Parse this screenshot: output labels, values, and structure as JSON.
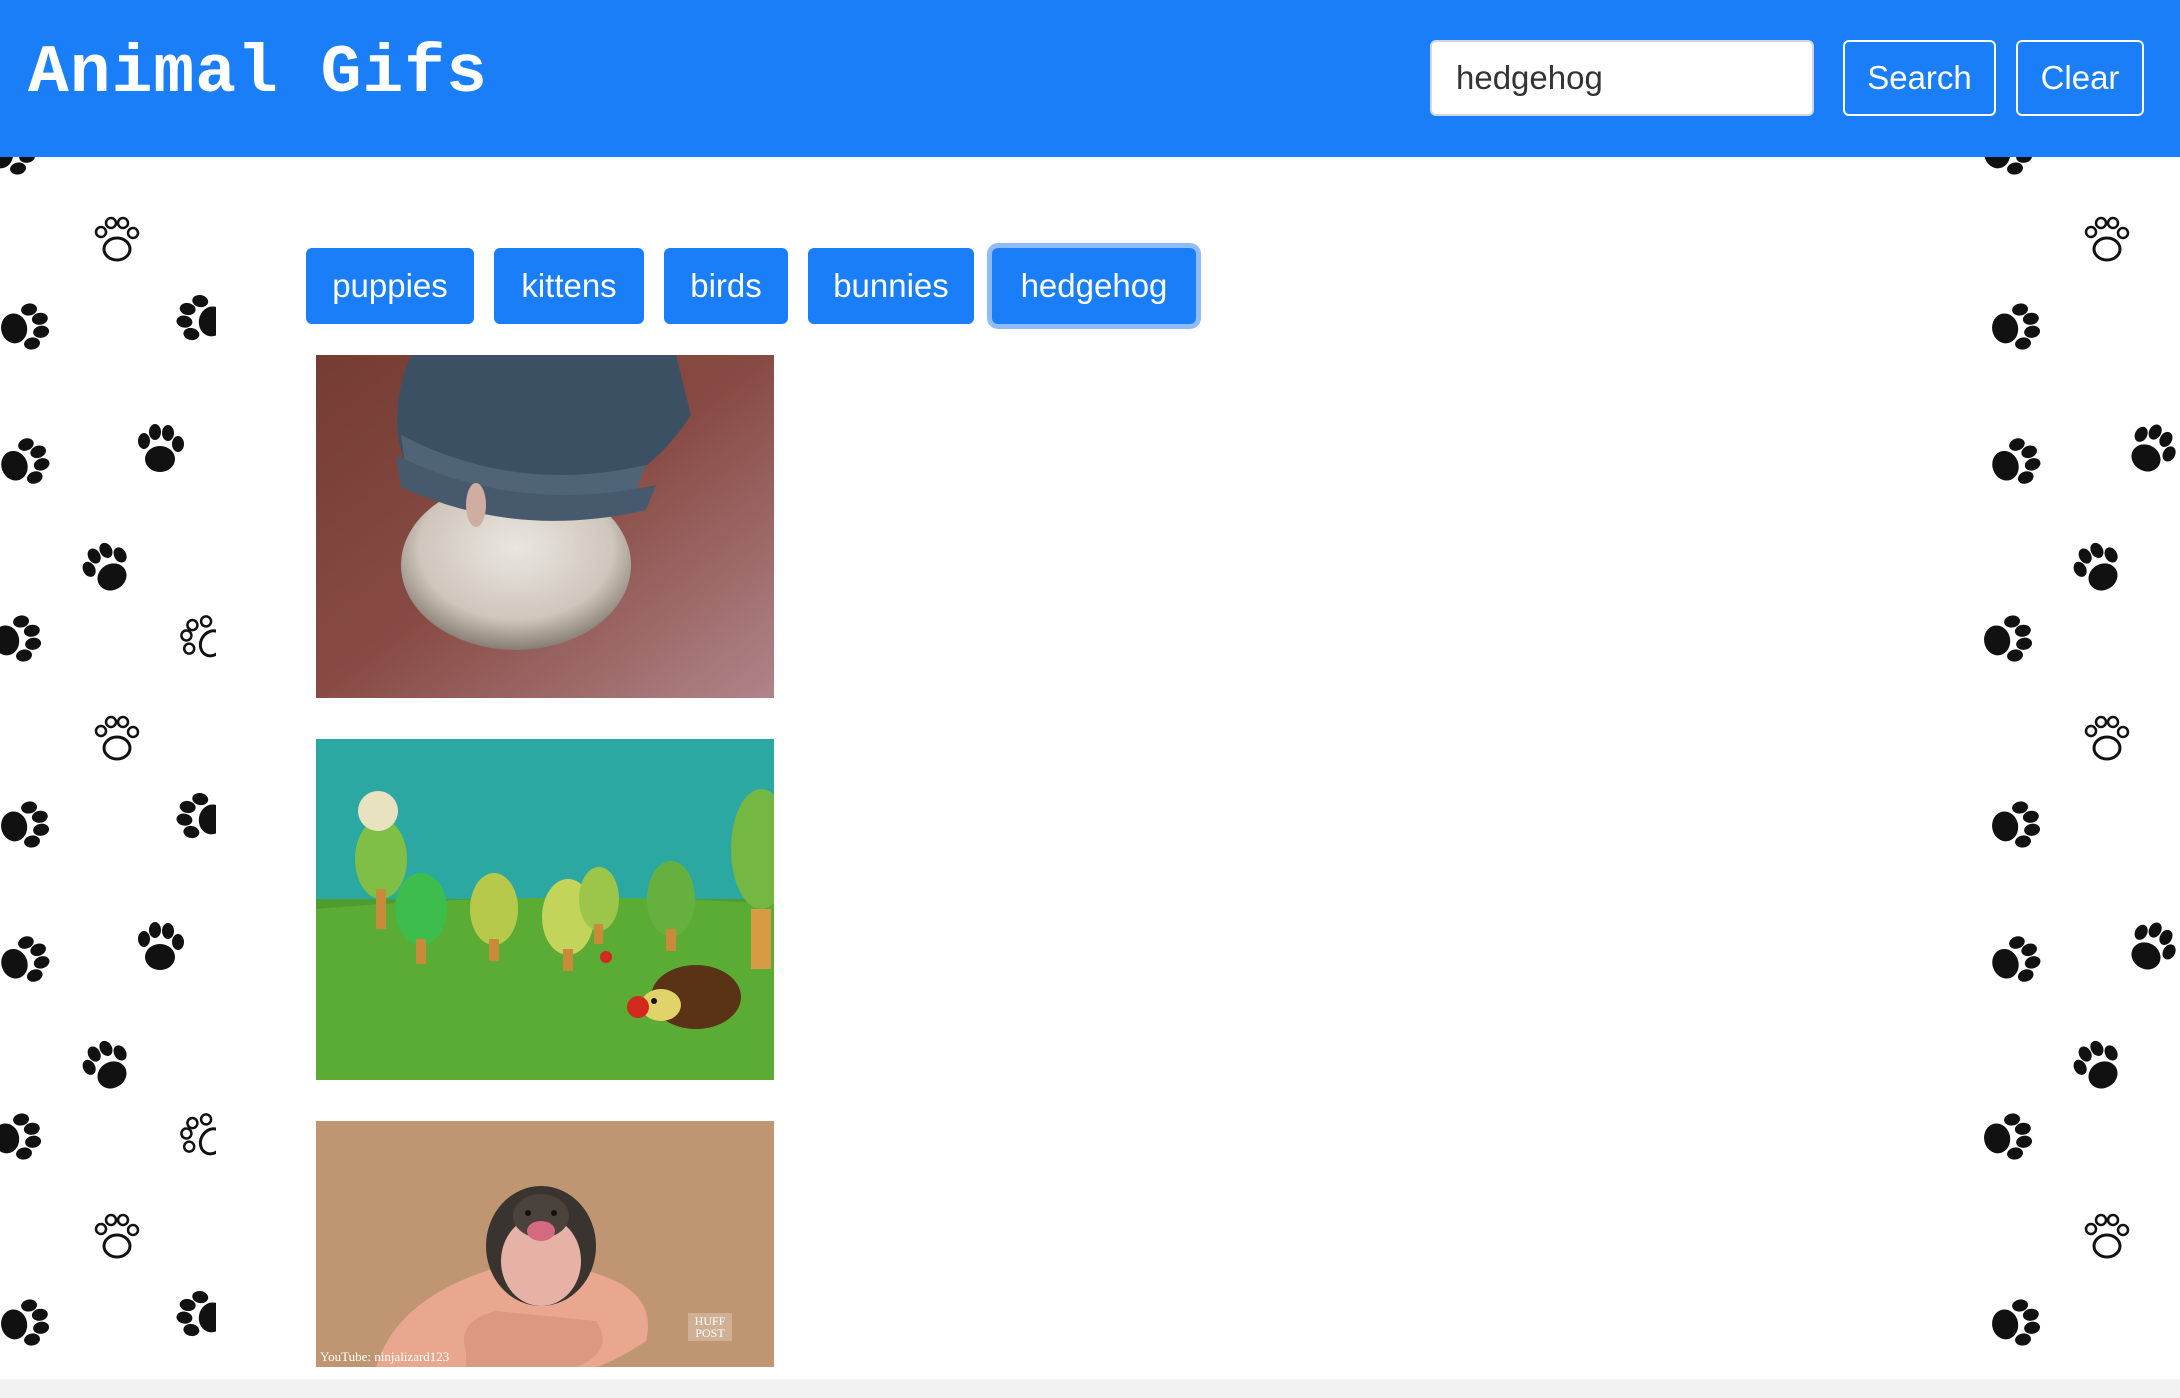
{
  "app": {
    "title": "Animal Gifs"
  },
  "search": {
    "value": "hedgehog",
    "search_label": "Search",
    "clear_label": "Clear"
  },
  "categories": [
    "puppies",
    "kittens",
    "birds",
    "bunnies",
    "hedgehog"
  ],
  "active_category": "hedgehog",
  "gifs": [
    {
      "subject": "hedgehog under knit hat"
    },
    {
      "subject": "knitted hedgehog with knitted trees"
    },
    {
      "subject": "baby hedgehog in hand",
      "caption": "YouTube: ninjalizard123",
      "watermark": "HUFF POST"
    }
  ],
  "colors": {
    "primary": "#197ef8",
    "focus_ring": "#8fbcf8",
    "background": "#ffffff",
    "paw": "#111111"
  },
  "icons": {
    "paw": "paw-print-icon"
  }
}
